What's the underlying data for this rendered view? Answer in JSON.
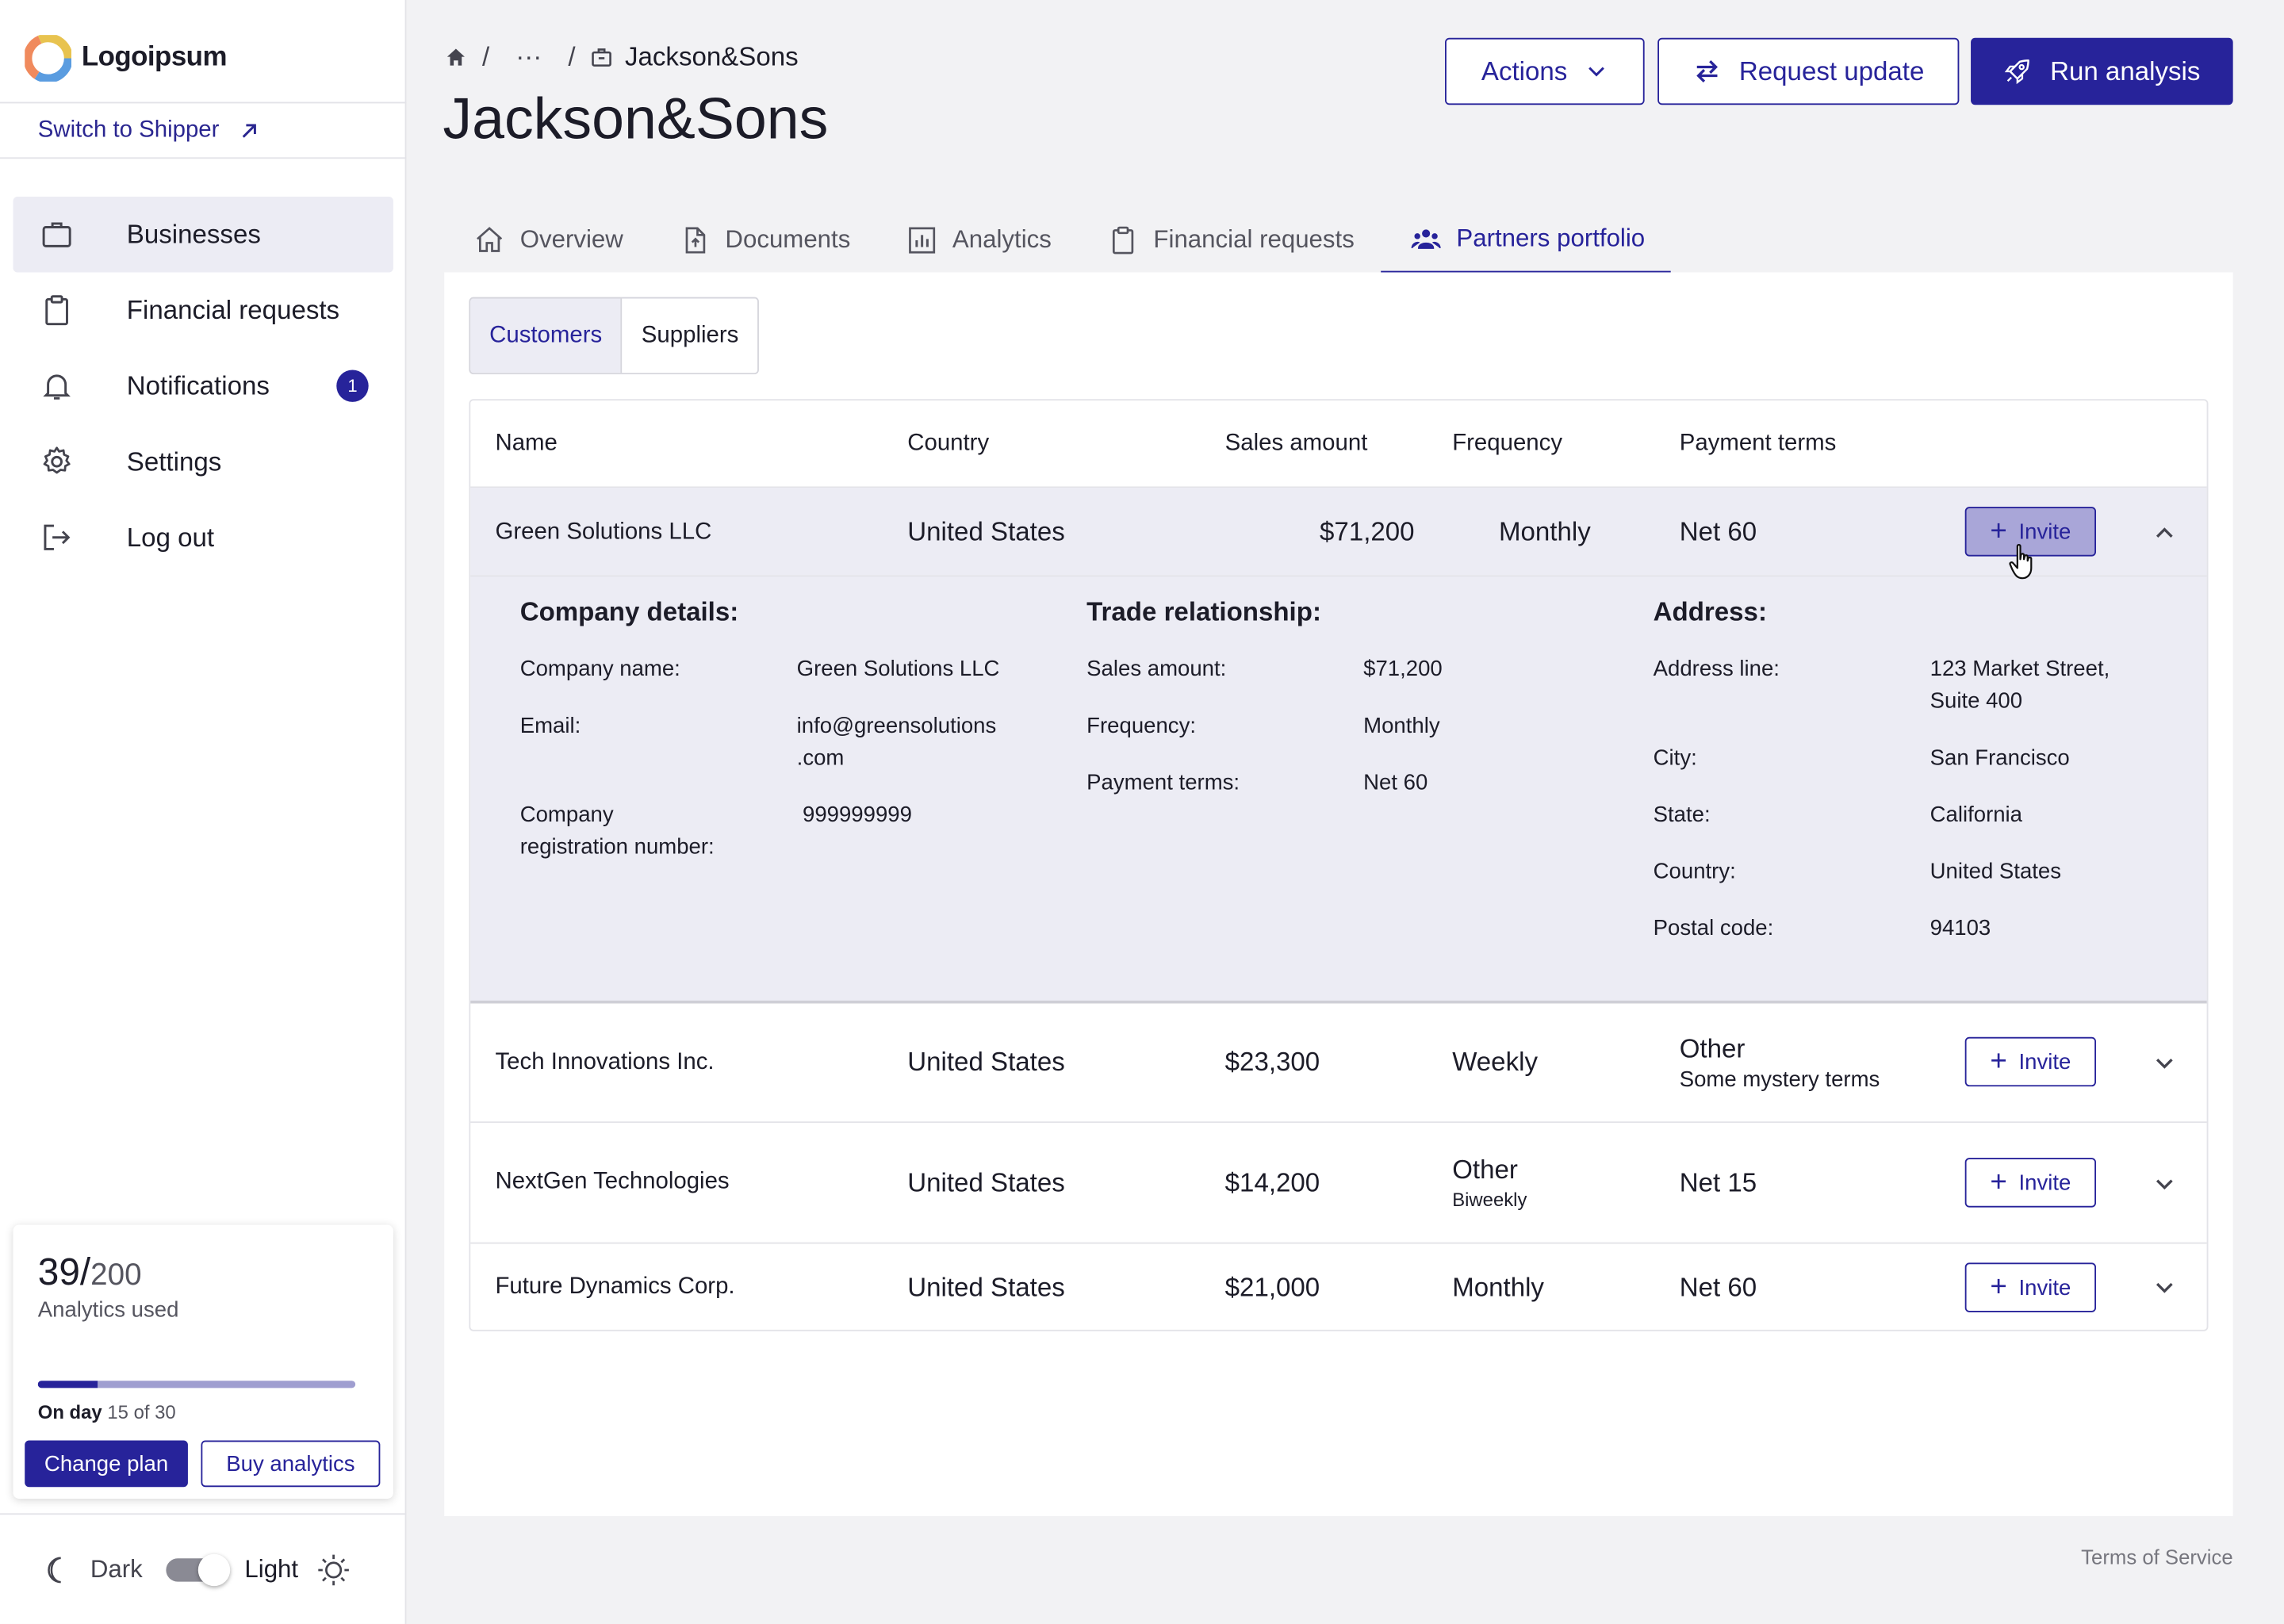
{
  "sidebar": {
    "logo_text": "Logoipsum",
    "switch_label": "Switch to Shipper",
    "nav": [
      {
        "label": "Businesses",
        "icon": "briefcase-icon",
        "active": true
      },
      {
        "label": "Financial requests",
        "icon": "clipboard-icon"
      },
      {
        "label": "Notifications",
        "icon": "bell-icon",
        "badge": "1"
      },
      {
        "label": "Settings",
        "icon": "gear-icon"
      },
      {
        "label": "Log out",
        "icon": "logout-icon"
      }
    ],
    "usage": {
      "used": "39/",
      "total": "200",
      "label": "Analytics used",
      "progress_fraction": 0.19,
      "day_prefix": "On day",
      "day_value": "15 of 30",
      "change_plan": "Change plan",
      "buy_analytics": "Buy analytics"
    },
    "theme": {
      "dark_label": "Dark",
      "light_label": "Light"
    }
  },
  "header": {
    "breadcrumb_ellipsis": "···",
    "breadcrumb_sep": "/",
    "breadcrumb_current": "Jackson&Sons",
    "title": "Jackson&Sons",
    "actions_label": "Actions",
    "request_label": "Request update",
    "run_label": "Run analysis"
  },
  "tabs": [
    {
      "label": "Overview",
      "icon": "home-icon"
    },
    {
      "label": "Documents",
      "icon": "document-upload-icon"
    },
    {
      "label": "Analytics",
      "icon": "bar-chart-icon"
    },
    {
      "label": "Financial requests",
      "icon": "clipboard-icon"
    },
    {
      "label": "Partners portfolio",
      "icon": "people-icon",
      "active": true
    }
  ],
  "segment": {
    "customers": "Customers",
    "suppliers": "Suppliers"
  },
  "table": {
    "columns": [
      "Name",
      "Country",
      "Sales amount",
      "Frequency",
      "Payment terms"
    ],
    "invite_label": "Invite",
    "rows": [
      {
        "name": "Green Solutions LLC",
        "country": "United States",
        "sales": "$71,200",
        "frequency": "Monthly",
        "terms": "Net 60"
      },
      {
        "name": "Tech Innovations Inc.",
        "country": "United States",
        "sales": "$23,300",
        "frequency": "Weekly",
        "terms": "Other",
        "terms_sub": "Some mystery terms"
      },
      {
        "name": "NextGen Technologies",
        "country": "United States",
        "sales": "$14,200",
        "frequency": "Other",
        "frequency_sub": "Biweekly",
        "terms": "Net 15"
      },
      {
        "name": "Future Dynamics Corp.",
        "country": "United States",
        "sales": "$21,000",
        "frequency": "Monthly",
        "terms": "Net 60"
      }
    ]
  },
  "details": {
    "company": {
      "heading": "Company details:",
      "name_label": "Company name:",
      "name_value": "Green Solutions LLC",
      "email_label": "Email:",
      "email_value_1": "info@greensolutions",
      "email_value_2": ".com",
      "reg_label_1": "Company",
      "reg_label_2": "registration number:",
      "reg_value": "999999999"
    },
    "trade": {
      "heading": "Trade relationship:",
      "sales_label": "Sales amount:",
      "sales_value": "$71,200",
      "freq_label": "Frequency:",
      "freq_value": "Monthly",
      "terms_label": "Payment terms:",
      "terms_value": "Net 60"
    },
    "address": {
      "heading": "Address:",
      "line_label": "Address line:",
      "line_value_1": "123 Market Street,",
      "line_value_2": "Suite 400",
      "city_label": "City:",
      "city_value": "San Francisco",
      "state_label": "State:",
      "state_value": "California",
      "country_label": "Country:",
      "country_value": "United States",
      "postal_label": "Postal code:",
      "postal_value": "94103"
    }
  },
  "footer": {
    "terms": "Terms of Service"
  },
  "colors": {
    "accent": "#27239a",
    "row_highlight": "#ececf4",
    "invite_hover": "#a9a6d8"
  }
}
